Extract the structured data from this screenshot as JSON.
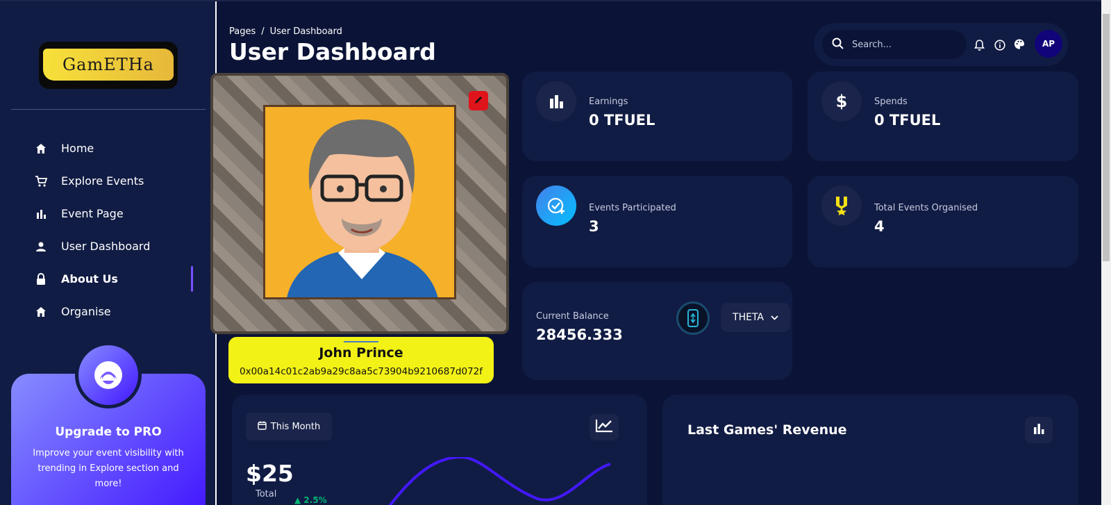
{
  "sidebar": {
    "logo_text": "GamETHa",
    "items": [
      {
        "label": "Home",
        "icon": "home-icon"
      },
      {
        "label": "Explore Events",
        "icon": "cart-icon"
      },
      {
        "label": "Event Page",
        "icon": "bar-chart-icon"
      },
      {
        "label": "User Dashboard",
        "icon": "person-icon"
      },
      {
        "label": "About Us",
        "icon": "lock-icon",
        "active": true
      },
      {
        "label": "Organise",
        "icon": "home-icon"
      }
    ],
    "promo": {
      "title": "Upgrade to PRO",
      "text": "Improve your event visibility with trending in Explore section and more!"
    }
  },
  "header": {
    "breadcrumb_root": "Pages",
    "breadcrumb_sep": "/",
    "breadcrumb_current": "User Dashboard",
    "title": "User Dashboard",
    "search_placeholder": "Search...",
    "avatar_initials": "AP"
  },
  "profile": {
    "name": "John Prince",
    "address": "0x00a14c01c2ab9a29c8aa5c73904b9210687d072f"
  },
  "stats": {
    "earnings": {
      "label": "Earnings",
      "value": "0 TFUEL"
    },
    "spends": {
      "label": "Spends",
      "value": "0 TFUEL"
    },
    "participated": {
      "label": "Events Participated",
      "value": "3"
    },
    "organised": {
      "label": "Total Events Organised",
      "value": "4"
    }
  },
  "balance": {
    "label": "Current Balance",
    "value": "28456.333",
    "currency": "THETA"
  },
  "monthly": {
    "period_label": "This Month",
    "value": "$25",
    "total_label": "Total",
    "change": "2.5%"
  },
  "revenue": {
    "title": "Last Games' Revenue"
  },
  "colors": {
    "background": "#0b1437",
    "card": "#111c44",
    "accent": "#7551ff",
    "name_card": "#f2f216",
    "positive": "#01b574"
  }
}
